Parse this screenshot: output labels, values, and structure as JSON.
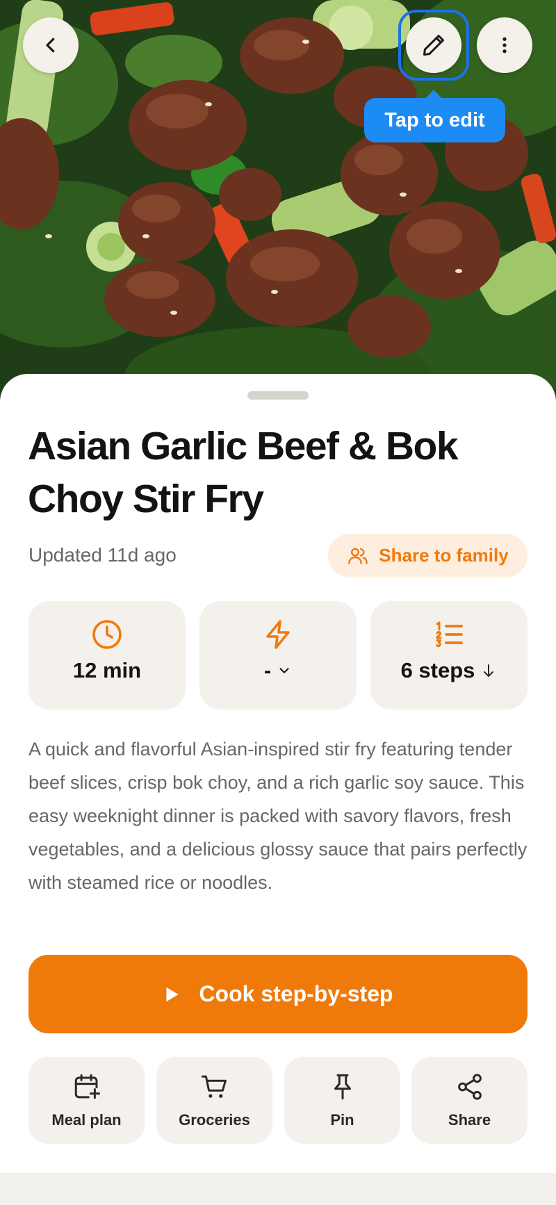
{
  "hero": {
    "tooltip": "Tap to edit",
    "icons": {
      "back": "chevron-left-icon",
      "edit": "pencil-icon",
      "more": "more-vertical-icon"
    }
  },
  "recipe": {
    "title": "Asian Garlic Beef & Bok Choy Stir Fry",
    "updated": "Updated 11d ago",
    "share_family": "Share to family",
    "description": "A quick and flavorful Asian-inspired stir fry featuring tender beef slices, crisp bok choy, and a rich garlic soy sauce. This easy weeknight dinner is packed with savory flavors, fresh vegetables, and a delicious glossy sauce that pairs perfectly with steamed rice or noodles."
  },
  "stats": [
    {
      "icon": "clock-icon",
      "value": "12 min"
    },
    {
      "icon": "lightning-icon",
      "value": "-"
    },
    {
      "icon": "numbered-list-icon",
      "value": "6 steps"
    }
  ],
  "cook": {
    "label": "Cook step-by-step",
    "icon": "play-icon"
  },
  "actions": [
    {
      "icon": "calendar-plus-icon",
      "label": "Meal plan"
    },
    {
      "icon": "cart-icon",
      "label": "Groceries"
    },
    {
      "icon": "pin-icon",
      "label": "Pin"
    },
    {
      "icon": "share-icon",
      "label": "Share"
    }
  ],
  "colors": {
    "accent": "#ef7a0a",
    "accent_soft": "#fdeee0",
    "focus_ring": "#1a73e8",
    "tooltip": "#1d8bf4",
    "card": "#f4f1ed"
  }
}
